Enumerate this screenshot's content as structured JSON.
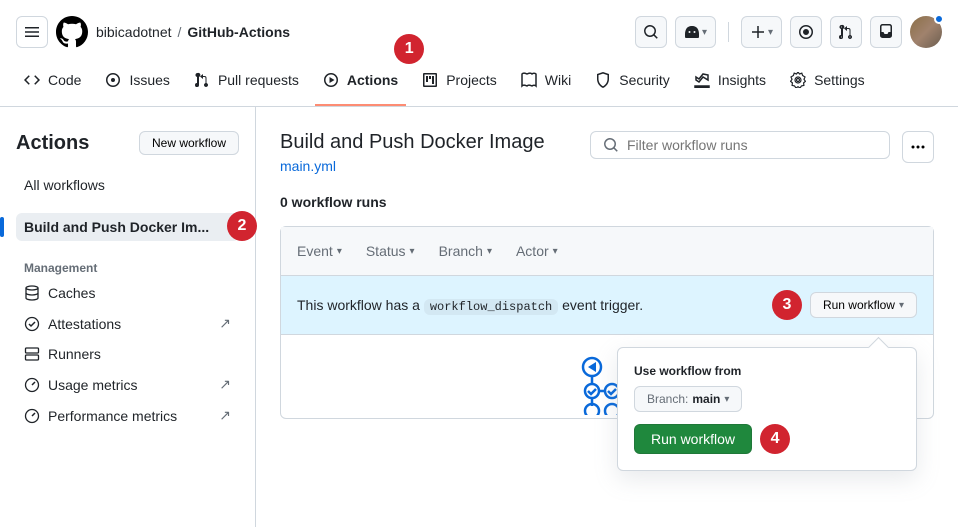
{
  "breadcrumb": {
    "owner": "bibicadotnet",
    "repo": "GitHub-Actions"
  },
  "nav": {
    "code": "Code",
    "issues": "Issues",
    "pulls": "Pull requests",
    "actions": "Actions",
    "projects": "Projects",
    "wiki": "Wiki",
    "security": "Security",
    "insights": "Insights",
    "settings": "Settings"
  },
  "sidebar": {
    "title": "Actions",
    "new_workflow": "New workflow",
    "all_workflows": "All workflows",
    "selected_workflow": "Build and Push Docker Im...",
    "section_label": "Management",
    "caches": "Caches",
    "attestations": "Attestations",
    "runners": "Runners",
    "usage_metrics": "Usage metrics",
    "performance_metrics": "Performance metrics"
  },
  "main": {
    "title": "Build and Push Docker Image",
    "file_link": "main.yml",
    "search_placeholder": "Filter workflow runs",
    "runs_count": "0 workflow runs"
  },
  "filters": {
    "event": "Event",
    "status": "Status",
    "branch": "Branch",
    "actor": "Actor"
  },
  "dispatch": {
    "text_prefix": "This workflow has a ",
    "code": "workflow_dispatch",
    "text_suffix": " event trigger.",
    "button": "Run workflow"
  },
  "dropdown": {
    "label": "Use workflow from",
    "branch_label": "Branch:",
    "branch_value": "main",
    "run_button": "Run workflow"
  },
  "callouts": {
    "c1": "1",
    "c2": "2",
    "c3": "3",
    "c4": "4"
  }
}
